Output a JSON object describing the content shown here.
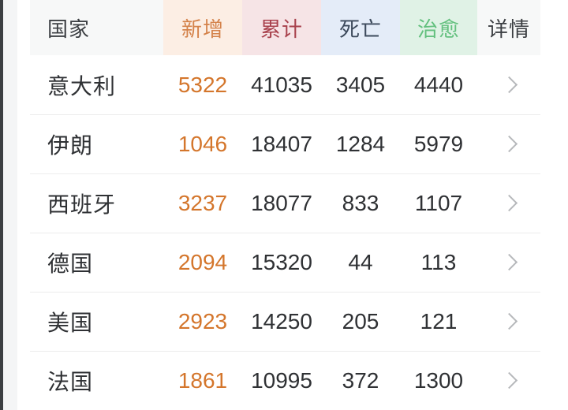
{
  "table": {
    "columns": [
      {
        "key": "country",
        "label": "国家",
        "bg": "#f7f8f8",
        "fg": "#3b3e42"
      },
      {
        "key": "new",
        "label": "新增",
        "bg": "#fceee4",
        "fg": "#d4824a"
      },
      {
        "key": "total",
        "label": "累计",
        "bg": "#f6e4e6",
        "fg": "#a8414c"
      },
      {
        "key": "deaths",
        "label": "死亡",
        "bg": "#e4ecf8",
        "fg": "#3d4a5c"
      },
      {
        "key": "cured",
        "label": "治愈",
        "bg": "#e0f2e6",
        "fg": "#63c07e"
      },
      {
        "key": "detail",
        "label": "详情",
        "bg": "#f7f8f8",
        "fg": "#3b3e42"
      }
    ],
    "rows": [
      {
        "country": "意大利",
        "new": "5322",
        "total": "41035",
        "deaths": "3405",
        "cured": "4440",
        "detail_icon": "chevron-right-icon"
      },
      {
        "country": "伊朗",
        "new": "1046",
        "total": "18407",
        "deaths": "1284",
        "cured": "5979",
        "detail_icon": "chevron-right-icon"
      },
      {
        "country": "西班牙",
        "new": "3237",
        "total": "18077",
        "deaths": "833",
        "cured": "1107",
        "detail_icon": "chevron-right-icon"
      },
      {
        "country": "德国",
        "new": "2094",
        "total": "15320",
        "deaths": "44",
        "cured": "113",
        "detail_icon": "chevron-right-icon"
      },
      {
        "country": "美国",
        "new": "2923",
        "total": "14250",
        "deaths": "205",
        "cured": "121",
        "detail_icon": "chevron-right-icon"
      },
      {
        "country": "法国",
        "new": "1861",
        "total": "10995",
        "deaths": "372",
        "cured": "1300",
        "detail_icon": "chevron-right-icon"
      }
    ]
  },
  "colors": {
    "new_value": "#d4762c",
    "value_text": "#2f3134",
    "divider": "#ececec",
    "chevron": "#b6b8bb",
    "page_background": "#ffffff",
    "gutter": "#f4f5f6",
    "edge": "#3c3f42"
  }
}
